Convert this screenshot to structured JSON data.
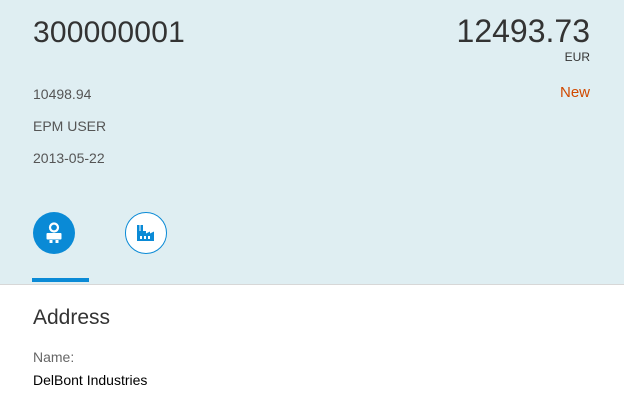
{
  "header": {
    "object_number": "300000001",
    "amount": "12493.73",
    "currency": "EUR",
    "attributes": [
      "10498.94",
      "EPM USER",
      "2013-05-22"
    ],
    "status": "New",
    "status_color": "#d14900",
    "background_color": "#dfeef2"
  },
  "tabs": [
    {
      "icon": "person-icon",
      "selected": true
    },
    {
      "icon": "factory-icon",
      "selected": false
    }
  ],
  "accent_color": "#0a8ad6",
  "section": {
    "title": "Address",
    "fields": [
      {
        "label": "Name:",
        "value": "DelBont Industries"
      }
    ]
  }
}
